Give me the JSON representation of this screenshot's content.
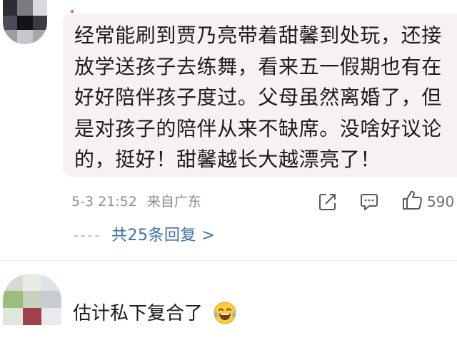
{
  "comment": {
    "text": "经常能刷到贾乃亮带着甜馨到处玩，还接放学送孩子去练舞，看来五一假期也有在好好陪伴孩子度过。父母虽然离婚了，但是对孩子的陪伴从来不缺席。没啥好议论的，挺好！甜馨越长大越漂亮了！",
    "timestamp": "5-3 21:52",
    "location": "来自广东",
    "like_count": "590",
    "replies_label": "共25条回复 >"
  },
  "next_comment": {
    "text": "估计私下复合了"
  },
  "icons": {
    "share": "share-icon",
    "comment": "comment-icon",
    "like": "thumbs-up-icon",
    "emoji": "laugh-cry-emoji-icon"
  },
  "colors": {
    "bubble_bg": "#f7f1f2",
    "link": "#3c6fa6",
    "meta": "#8c8c8c"
  }
}
